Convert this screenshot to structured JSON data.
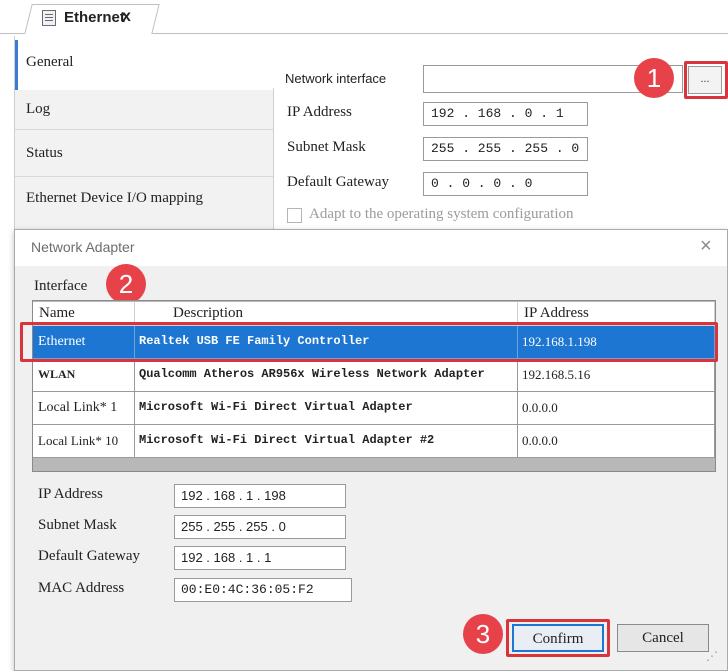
{
  "tab": {
    "label": "Ethernet",
    "close": "x"
  },
  "sidebar": {
    "items": [
      {
        "label": "General"
      },
      {
        "label": "Log"
      },
      {
        "label": "Status"
      },
      {
        "label": "Ethernet Device I/O mapping"
      }
    ]
  },
  "general": {
    "network_interface_label": "Network interface",
    "network_interface_value": "",
    "browse_label": "...",
    "ip_label": "IP Address",
    "ip_value": "192 . 168 . 0 . 1",
    "mask_label": "Subnet Mask",
    "mask_value": "255 . 255 . 255 . 0",
    "gateway_label": "Default Gateway",
    "gateway_value": "0 . 0 . 0 . 0",
    "adapt_label": "Adapt to the operating system configuration",
    "adapt_checked": false
  },
  "dialog": {
    "title": "Network Adapter",
    "close": "×",
    "interface_label": "Interface",
    "columns": [
      "Name",
      "Description",
      "IP Address"
    ],
    "rows": [
      [
        "Ethernet",
        "Realtek USB FE Family Controller",
        "192.168.1.198"
      ],
      [
        "WLAN",
        "Qualcomm Atheros AR956x Wireless Network Adapter",
        "192.168.5.16"
      ],
      [
        "Local Link* 1",
        "Microsoft Wi-Fi Direct Virtual Adapter",
        "0.0.0.0"
      ],
      [
        "Local Link* 10",
        "Microsoft Wi-Fi Direct Virtual Adapter #2",
        "0.0.0.0"
      ]
    ],
    "selected_row": 0,
    "details": {
      "ip_label": "IP Address",
      "ip_value": "192 . 168 .  1  . 198",
      "mask_label": "Subnet Mask",
      "mask_value": "255 . 255 . 255 .  0",
      "gateway_label": "Default Gateway",
      "gateway_value": "192 . 168 .  1  .  1",
      "mac_label": "MAC Address",
      "mac_value": "00:E0:4C:36:05:F2"
    },
    "confirm_label": "Confirm",
    "cancel_label": "Cancel",
    "grip": "⋰"
  },
  "annotations": {
    "step1": "1",
    "step2": "2",
    "step3": "3",
    "color": "#e7424a",
    "highlight_color": "#d9343b"
  },
  "colors": {
    "selection": "#1c76d2"
  }
}
